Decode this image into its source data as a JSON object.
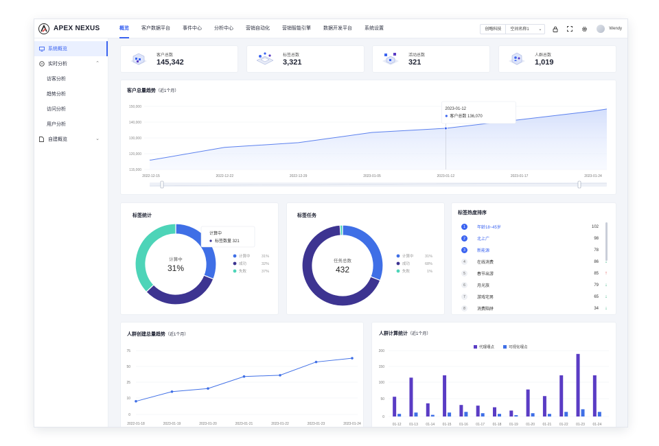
{
  "brand": {
    "name": "APEX NEXUS"
  },
  "nav": [
    {
      "label": "概览",
      "active": true
    },
    {
      "label": "客户数据平台"
    },
    {
      "label": "事件中心"
    },
    {
      "label": "分析中心"
    },
    {
      "label": "营销自动化"
    },
    {
      "label": "营销智能引擎"
    },
    {
      "label": "数据开发平台"
    },
    {
      "label": "系统设置"
    }
  ],
  "header": {
    "company": "创略科技",
    "space": "空间名称1",
    "user": "Wendy"
  },
  "sidebar": [
    {
      "label": "系统概览",
      "active": true,
      "icon": "monitor-icon"
    },
    {
      "label": "实时分析",
      "icon": "clock-icon",
      "expanded": true
    },
    {
      "label": "访客分析",
      "sub": true
    },
    {
      "label": "趋势分析",
      "sub": true
    },
    {
      "label": "访问分析",
      "sub": true
    },
    {
      "label": "用户分析",
      "sub": true
    },
    {
      "label": "自建概览",
      "icon": "document-icon"
    }
  ],
  "stats": [
    {
      "label": "客户总数",
      "value": "145,342"
    },
    {
      "label": "标签总数",
      "value": "3,321"
    },
    {
      "label": "活动总数",
      "value": "321"
    },
    {
      "label": "人群总数",
      "value": "1,019"
    }
  ],
  "colors": {
    "primary": "#3a63f0",
    "purple": "#3d3491",
    "teal": "#4dd4b8",
    "violet": "#5a3cc4",
    "blue2": "#3f6fe6",
    "up": "#e04545",
    "down": "#2daa7a"
  },
  "trend": {
    "title": "客户总量趋势",
    "subtitle": "（近1个月）",
    "tooltip": {
      "date": "2023-01-12",
      "label": "客户总数",
      "value": "136,070"
    },
    "chart_data": {
      "type": "area",
      "x": [
        "2022-12-15",
        "2022-12-22",
        "2022-12-29",
        "2023-01-05",
        "2023-01-12",
        "2023-01-17",
        "2023-01-24"
      ],
      "series": [
        {
          "name": "客户总数",
          "values": [
            118000,
            124000,
            127000,
            133500,
            136070,
            141500,
            147000
          ]
        }
      ],
      "ylim": [
        115000,
        150000
      ],
      "yticks": [
        "150,000",
        "140,000",
        "130,000",
        "120,000",
        "115,000"
      ],
      "grid": true
    }
  },
  "tagStats": {
    "title": "标签统计",
    "center_label": "计算中",
    "center_value": "31%",
    "tooltip": {
      "title": "计算中",
      "label": "标签数量",
      "value": "321"
    },
    "chart_data": {
      "type": "pie",
      "categories": [
        "计算中",
        "成功",
        "失败"
      ],
      "values": [
        31,
        32,
        37
      ],
      "labels": [
        "31%",
        "32%",
        "37%"
      ]
    }
  },
  "tagTasks": {
    "title": "标签任务",
    "center_label": "任务总数",
    "center_value": "432",
    "chart_data": {
      "type": "pie",
      "categories": [
        "计算中",
        "成功",
        "失败"
      ],
      "values": [
        31,
        68,
        1
      ],
      "labels": [
        "31%",
        "68%",
        "1%"
      ]
    }
  },
  "ranking": {
    "title": "标签热度排序",
    "rows": [
      {
        "rank": "1",
        "name": "年龄18~45岁",
        "value": "102",
        "dir": "up",
        "hot": true
      },
      {
        "rank": "2",
        "name": "北上广",
        "value": "98",
        "dir": "down",
        "hot": true
      },
      {
        "rank": "3",
        "name": "新能源",
        "value": "78",
        "dir": "up",
        "hot": true
      },
      {
        "rank": "4",
        "name": "在线消费",
        "value": "86",
        "dir": "down"
      },
      {
        "rank": "5",
        "name": "春节出游",
        "value": "85",
        "dir": "up"
      },
      {
        "rank": "6",
        "name": "月光族",
        "value": "79",
        "dir": "down"
      },
      {
        "rank": "7",
        "name": "游戏宅男",
        "value": "65",
        "dir": "down"
      },
      {
        "rank": "8",
        "name": "消费陷阱",
        "value": "34",
        "dir": "down"
      }
    ]
  },
  "crowdTrend": {
    "title": "人群创建总量趋势",
    "subtitle": "（近1个月）",
    "chart_data": {
      "type": "line",
      "x": [
        "2022-01-18",
        "2023-01-19",
        "2023-01-20",
        "2023-01-21",
        "2023-01-22",
        "2023-01-23",
        "2023-01-24"
      ],
      "series": [
        {
          "values": [
            8,
            16,
            19,
            34,
            36,
            57,
            63
          ]
        }
      ],
      "ylim": [
        0,
        75
      ],
      "yticks": [
        "75",
        "50",
        "25",
        "10",
        "0"
      ]
    }
  },
  "crowdCalc": {
    "title": "人群计算统计",
    "subtitle": "（近1个月）",
    "chart_data": {
      "type": "bar",
      "categories": [
        "01-12",
        "01-13",
        "01-14",
        "01-15",
        "01-16",
        "01-17",
        "01-18",
        "01-19",
        "01-20",
        "01-21",
        "01-22",
        "01-23",
        "01-24"
      ],
      "series": [
        {
          "name": "代理埋点",
          "values": [
            60,
            118,
            40,
            125,
            35,
            33,
            28,
            18,
            82,
            62,
            125,
            190,
            125
          ]
        },
        {
          "name": "可视化埋点",
          "values": [
            8,
            12,
            5,
            12,
            14,
            10,
            8,
            4,
            10,
            8,
            14,
            22,
            14
          ]
        }
      ],
      "ylim": [
        0,
        200
      ],
      "yticks": [
        "200",
        "150",
        "100",
        "50",
        "0"
      ]
    }
  }
}
